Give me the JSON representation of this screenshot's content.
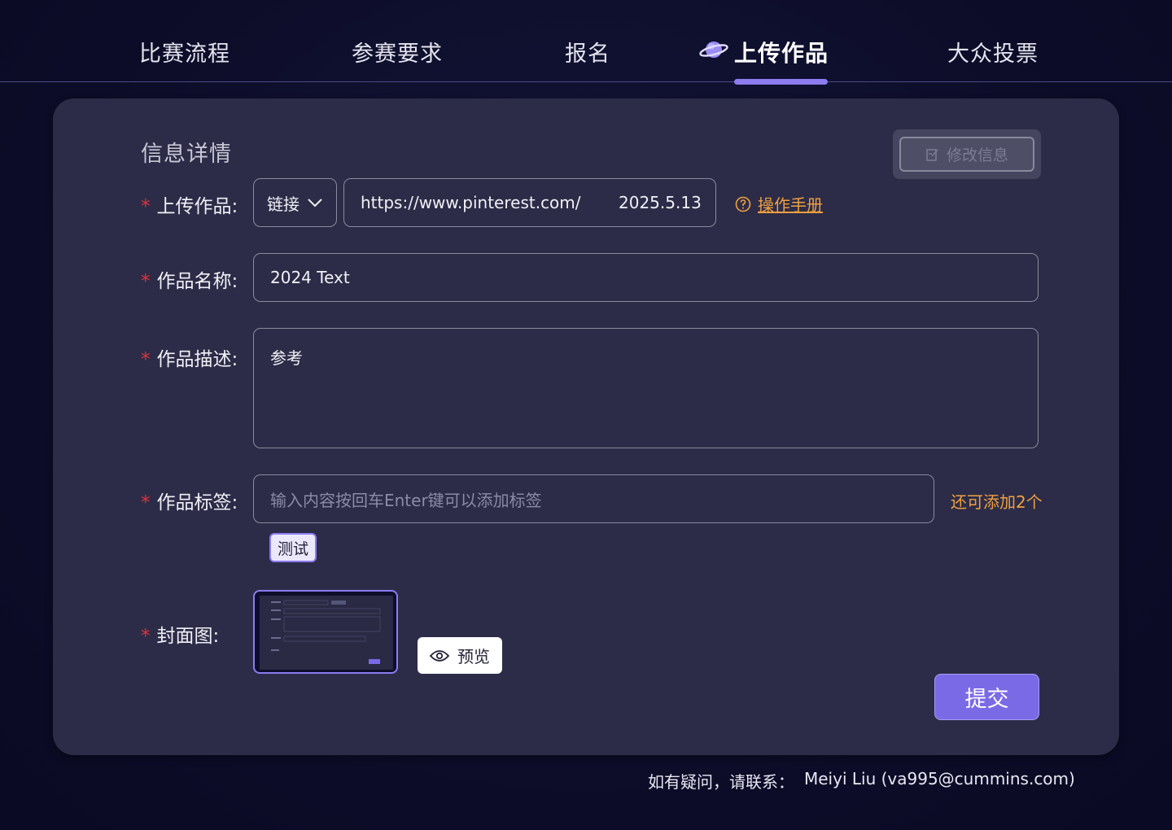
{
  "nav": {
    "tabs": [
      {
        "label": "比赛流程"
      },
      {
        "label": "参赛要求"
      },
      {
        "label": "报名"
      },
      {
        "label": "上传作品"
      },
      {
        "label": "大众投票"
      }
    ],
    "active_index": 3,
    "active_icon": "planet-icon"
  },
  "form": {
    "title": "信息详情",
    "edit_button": "修改信息",
    "required_mark": "*",
    "upload": {
      "label": "上传作品:",
      "type_value": "链接",
      "url_value": "https://www.pinterest.com/",
      "date_value": "2025.5.13",
      "manual_link": "操作手册"
    },
    "name": {
      "label": "作品名称:",
      "value": "2024 Text"
    },
    "description": {
      "label": "作品描述:",
      "value": "参考"
    },
    "tags": {
      "label": "作品标签:",
      "placeholder": "输入内容按回车Enter键可以添加标签",
      "remaining": "还可添加2个",
      "items": [
        "测试"
      ]
    },
    "cover": {
      "label": "封面图:",
      "preview_button": "预览"
    },
    "submit": "提交"
  },
  "footer": {
    "contact_prompt": "如有疑问，请联系：",
    "contact": "Meiyi Liu (va995@cummins.com)"
  },
  "colors": {
    "accent": "#8c7cf0",
    "submit": "#7b6ae6",
    "required": "#e0303a",
    "warning": "#f0a040",
    "card": "#2c2c48",
    "background": "#0e0e2c"
  }
}
